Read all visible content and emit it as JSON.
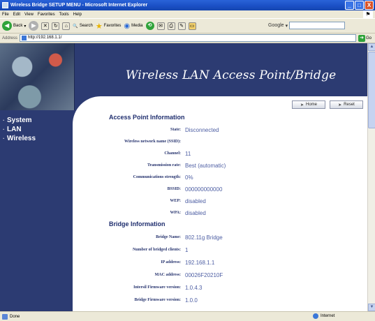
{
  "window": {
    "title": "Wireless Bridge SETUP MENU - Microsoft Internet Explorer",
    "minimize": "_",
    "maximize": "□",
    "close": "X"
  },
  "menubar": {
    "items": [
      "File",
      "Edit",
      "View",
      "Favorites",
      "Tools",
      "Help"
    ]
  },
  "toolbar": {
    "back_label": "Back",
    "search_label": "Search",
    "favorites_label": "Favorites",
    "media_label": "Media",
    "google_label": "Google"
  },
  "address": {
    "label": "Address",
    "url": "http://192.168.1.1/",
    "go_label": "Go"
  },
  "banner": {
    "title": "Wireless LAN Access Point/Bridge"
  },
  "nav": {
    "items": [
      {
        "label": "System"
      },
      {
        "label": "LAN"
      },
      {
        "label": "Wireless"
      }
    ]
  },
  "buttons": {
    "home": "Home",
    "reset": "Reset"
  },
  "access_point": {
    "title": "Access Point Information",
    "rows": [
      {
        "label": "State:",
        "value": "Disconnected"
      },
      {
        "label": "Wireless network name (SSID):",
        "value": ""
      },
      {
        "label": "Channel:",
        "value": "11"
      },
      {
        "label": "Transmission rate:",
        "value": "Best (automatic)"
      },
      {
        "label": "Communications strength:",
        "value": "0%"
      },
      {
        "label": "BSSID:",
        "value": "000000000000"
      },
      {
        "label": "WEP:",
        "value": "disabled"
      },
      {
        "label": "WPA:",
        "value": "disabled"
      }
    ]
  },
  "bridge": {
    "title": "Bridge Information",
    "rows": [
      {
        "label": "Bridge Name:",
        "value": "802.11g Bridge"
      },
      {
        "label": "Number of bridged clients:",
        "value": "1"
      },
      {
        "label": "IP address:",
        "value": "192.168.1.1"
      },
      {
        "label": "MAC address:",
        "value": "00026F20210F"
      },
      {
        "label": "Intersil Firmware version:",
        "value": "1.0.4.3"
      },
      {
        "label": "Bridge Firmware version:",
        "value": "1.0.0"
      }
    ]
  },
  "status": {
    "text": "Done",
    "zone": "Internet"
  }
}
